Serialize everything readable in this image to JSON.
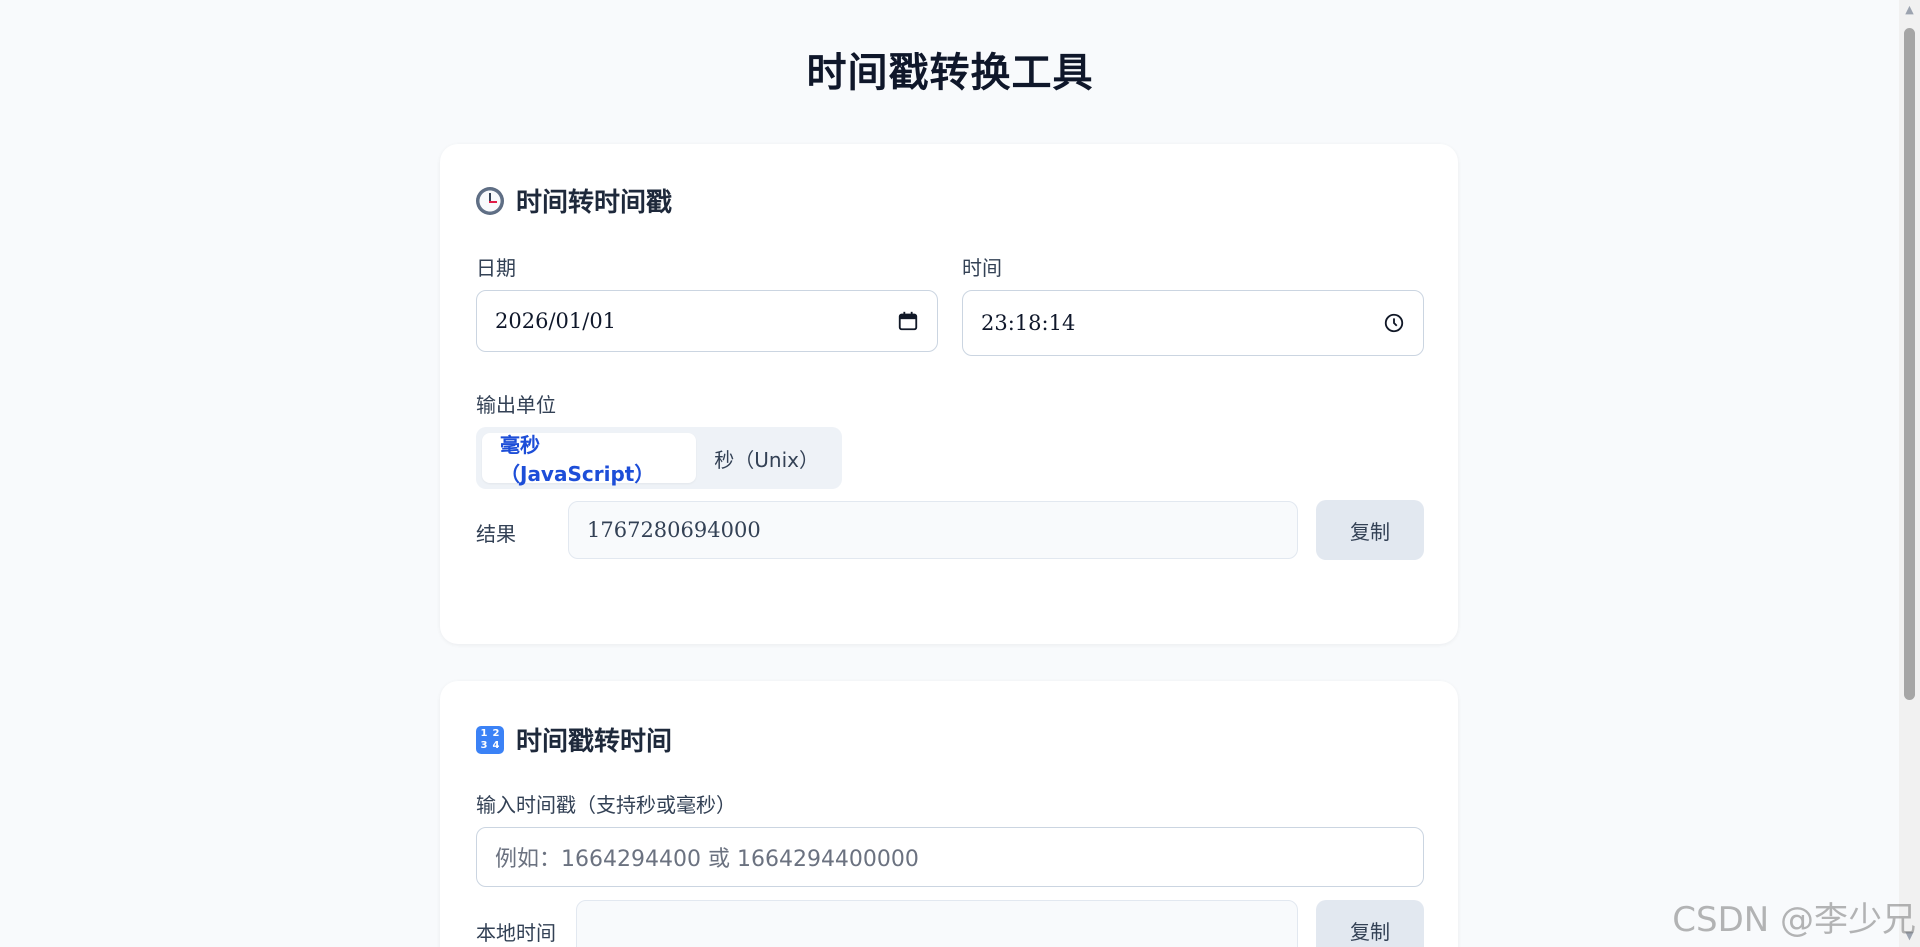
{
  "page": {
    "title": "时间戳转换工具"
  },
  "card1": {
    "heading": "时间转时间戳",
    "date_label": "日期",
    "date_value": "2026/01/01",
    "time_label": "时间",
    "time_value": "23:18:14",
    "unit_label": "输出单位",
    "units": [
      "毫秒（JavaScript）",
      "秒（Unix）"
    ],
    "selected_unit": "毫秒（JavaScript）",
    "result_label": "结果",
    "result_value": "1767280694000",
    "copy_label": "复制"
  },
  "card2": {
    "heading": "时间戳转时间",
    "input_label": "输入时间戳（支持秒或毫秒）",
    "input_placeholder": "例如：1664294400 或 1664294400000",
    "local_label": "本地时间",
    "local_value": "",
    "copy_label": "复制"
  },
  "watermark": "CSDN @李少兄",
  "icons": {
    "card1_icon": "clock-icon",
    "card2_icon": "numbers-icon",
    "date_icon": "calendar-icon",
    "time_icon": "clock-outline-icon"
  }
}
